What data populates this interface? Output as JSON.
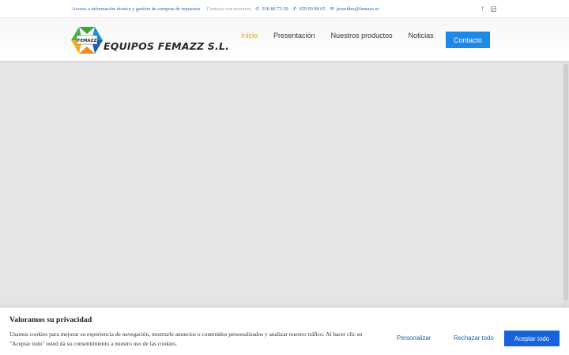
{
  "topbar": {
    "info_link": "Acceso a información técnica y gestión de compras de repuestos",
    "contact_label": "Contacte con nosotros",
    "phone1": "918 86 73 39",
    "phone2": "659 00 88 65",
    "email": "jesusfdez@femazz.es",
    "social": [
      "facebook-icon",
      "instagram-icon"
    ]
  },
  "header": {
    "logo_badge": "FEMAZZ",
    "logo_text": "EQUIPOS FEMAZZ S.L.",
    "nav": [
      "Inicio",
      "Presentación",
      "Nuestros productos",
      "Noticias"
    ],
    "cta": "Contacto",
    "colors": {
      "active": "#e0a21a",
      "cta": "#1e88e5"
    }
  },
  "cookie": {
    "title": "Valoramos su privacidad",
    "text": "Usamos cookies para mejorar su experiencia de navegación, mostrarle anuncios o contenidos personalizados y analizar nuestro tráfico. Al hacer clic en \"Aceptar todo\" usted da su consentimiento a nuestro uso de las cookies.",
    "customize": "Personalizar",
    "reject": "Rechazar todo",
    "accept": "Aceptar todo",
    "colors": {
      "accept": "#1863dc",
      "link": "#1a66b3"
    }
  }
}
